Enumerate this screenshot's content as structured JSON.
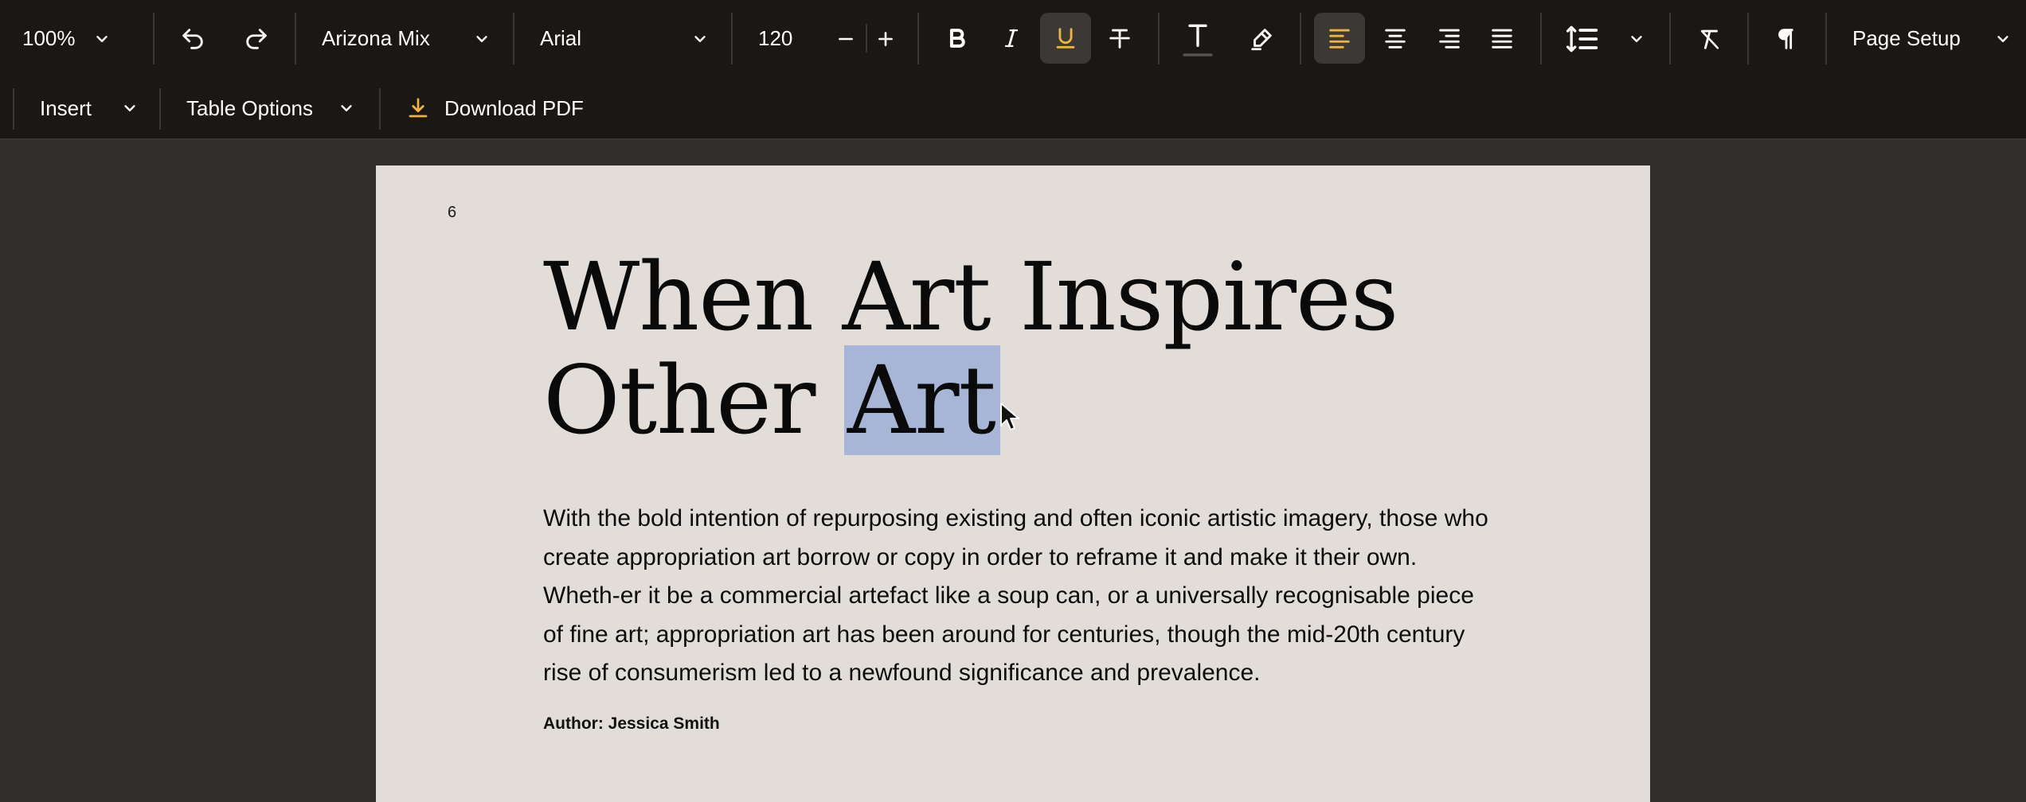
{
  "toolbar": {
    "zoom": "100%",
    "style_name": "Arizona Mix",
    "font_family": "Arial",
    "font_size": "120",
    "page_setup_label": "Page Setup",
    "insert_label": "Insert",
    "table_options_label": "Table Options",
    "download_label": "Download PDF",
    "icons": [
      "undo-icon",
      "redo-icon",
      "minus-icon",
      "plus-icon",
      "bold-icon",
      "italic-icon",
      "underline-icon",
      "strikethrough-icon",
      "text-color-icon",
      "highlighter-icon",
      "align-left-icon",
      "align-center-icon",
      "align-right-icon",
      "align-justify-icon",
      "line-spacing-icon",
      "clear-formatting-icon",
      "pilcrow-icon",
      "download-icon"
    ],
    "accent_color": "#f0b43c",
    "active_states": {
      "underline": true,
      "align_left": true
    }
  },
  "document": {
    "page_number": "6",
    "title_line1": "When Art Inspires",
    "title_line2_pre": "Other ",
    "title_line2_selected": "Art",
    "body": "With the bold intention of repurposing existing and often iconic artistic imagery, those who create appropriation art borrow or copy in order to reframe it and make it their own. Wheth-er it be a commercial artefact like a soup can, or a universally recognisable piece of fine art; appropriation art has been around for centuries, though the mid-20th century rise of consumerism led to a newfound significance and prevalence.",
    "author": "Author: Jessica Smith"
  },
  "colors": {
    "toolbar_bg": "#1b1715",
    "canvas_bg": "#302d2b",
    "page_bg": "#e2ddd9",
    "selection": "#a7b6d6"
  }
}
